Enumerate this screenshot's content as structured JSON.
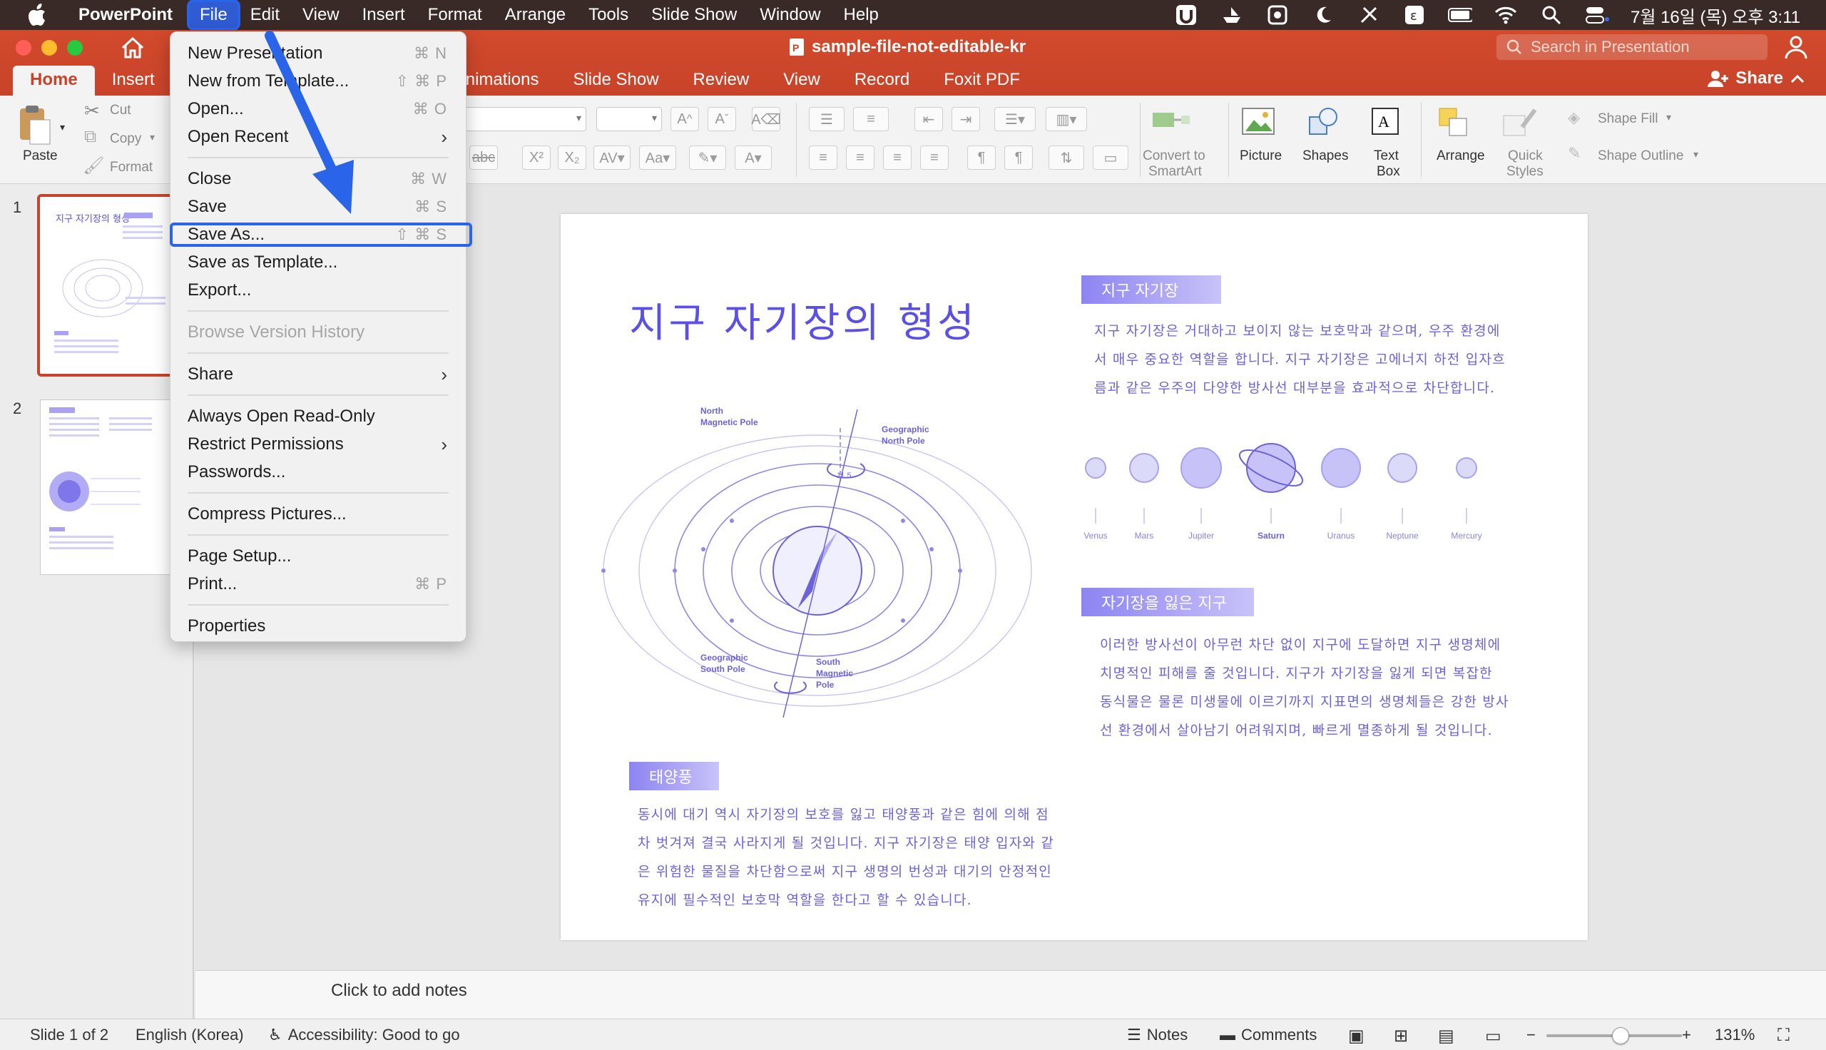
{
  "menubar": {
    "app": "PowerPoint",
    "items": [
      "File",
      "Edit",
      "View",
      "Insert",
      "Format",
      "Arrange",
      "Tools",
      "Slide Show",
      "Window",
      "Help"
    ],
    "clock": "7월 16일 (목) 오후 3:11"
  },
  "window": {
    "title": "sample-file-not-editable-kr",
    "search_placeholder": "Search in Presentation",
    "share": "Share"
  },
  "tabs": [
    "Home",
    "Insert",
    "Animations",
    "Slide Show",
    "Review",
    "View",
    "Record",
    "Foxit PDF"
  ],
  "ribbon": {
    "paste": "Paste",
    "cut": "Cut",
    "copy": "Copy",
    "format": "Format",
    "convert": "Convert to",
    "smartart": "SmartArt",
    "picture": "Picture",
    "shapes": "Shapes",
    "text": "Text",
    "box": "Box",
    "arrange": "Arrange",
    "quick": "Quick",
    "styles": "Styles",
    "shape_fill": "Shape Fill",
    "shape_outline": "Shape Outline"
  },
  "file_menu": {
    "items": [
      {
        "label": "New Presentation",
        "shortcut": "⌘ N"
      },
      {
        "label": "New from Template...",
        "shortcut": "⇧ ⌘ P"
      },
      {
        "label": "Open...",
        "shortcut": "⌘ O"
      },
      {
        "label": "Open Recent",
        "shortcut": ""
      },
      {
        "label": "Close",
        "shortcut": "⌘ W"
      },
      {
        "label": "Save",
        "shortcut": "⌘ S"
      },
      {
        "label": "Save As...",
        "shortcut": "⇧ ⌘ S"
      },
      {
        "label": "Save as Template...",
        "shortcut": ""
      },
      {
        "label": "Export...",
        "shortcut": ""
      },
      {
        "label": "Browse Version History",
        "shortcut": ""
      },
      {
        "label": "Share",
        "shortcut": ""
      },
      {
        "label": "Always Open Read-Only",
        "shortcut": ""
      },
      {
        "label": "Restrict Permissions",
        "shortcut": ""
      },
      {
        "label": "Passwords...",
        "shortcut": ""
      },
      {
        "label": "Compress Pictures...",
        "shortcut": ""
      },
      {
        "label": "Page Setup...",
        "shortcut": ""
      },
      {
        "label": "Print...",
        "shortcut": "⌘ P"
      },
      {
        "label": "Properties",
        "shortcut": ""
      }
    ]
  },
  "sidebar": {
    "slide_numbers": [
      "1",
      "2"
    ],
    "thumb_title": "지구 자기장의 형성"
  },
  "slide": {
    "title": "지구 자기장의 형성",
    "section1_label": "지구 자기장",
    "section1_lines": [
      "지구 자기장은 거대하고 보이지 않는 보호막과 같으며, 우주 환경에",
      "서 매우 중요한 역할을 합니다. 지구 자기장은 고에너지 하전 입자흐",
      "름과 같은 우주의 다양한 방사선 대부분을 효과적으로 차단합니다."
    ],
    "section2_label": "자기장을 잃은 지구",
    "section2_lines": [
      "이러한 방사선이 아무런 차단 없이 지구에 도달하면 지구 생명체에",
      "치명적인 피해를 줄 것입니다. 지구가 자기장을 잃게 되면 복잡한",
      "동식물은 물론 미생물에 이르기까지 지표면의 생명체들은 강한 방사",
      "선 환경에서 살아남기 어려워지며, 빠르게 멸종하게 될 것입니다."
    ],
    "section3_label": "태양풍",
    "section3_lines": [
      "동시에 대기 역시 자기장의 보호를 잃고 태양풍과 같은 힘에 의해 점",
      "차 벗겨져 결국 사라지게 될 것입니다. 지구 자기장은 태양 입자와 같",
      "은 위험한 물질을 차단함으로써 지구 생명의 번성과 대기의 안정적인",
      "유지에 필수적인 보호막 역할을 한다고 할 수 있습니다."
    ],
    "diagram": {
      "north_magnetic": [
        "North",
        "Magnetic Pole"
      ],
      "geo_north": [
        "Geographic",
        "North Pole"
      ],
      "geo_south": [
        "Geographic",
        "South Pole"
      ],
      "south_magnetic": [
        "South",
        "Magnetic",
        "Pole"
      ],
      "angle": "11.5"
    },
    "planets": [
      "Venus",
      "Mars",
      "Jupiter",
      "Saturn",
      "Uranus",
      "Neptune",
      "Mercury"
    ]
  },
  "notes": {
    "placeholder": "Click to add notes"
  },
  "status": {
    "slide": "Slide 1 of 2",
    "language": "English (Korea)",
    "accessibility": "Accessibility: Good to go",
    "notes": "Notes",
    "comments": "Comments",
    "zoom": "131%"
  }
}
